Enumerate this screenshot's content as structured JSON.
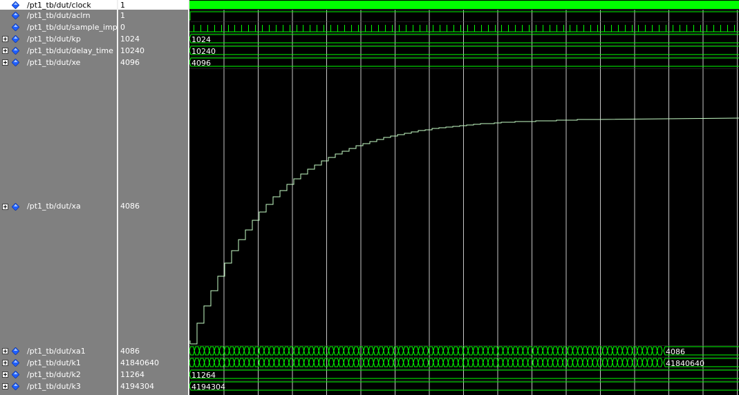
{
  "signals": [
    {
      "name": "/pt1_tb/dut/clock",
      "value": "1",
      "expandable": false,
      "selected": true,
      "kind": "clock"
    },
    {
      "name": "/pt1_tb/dut/aclrn",
      "value": "1",
      "expandable": false,
      "selected": false,
      "kind": "logic"
    },
    {
      "name": "/pt1_tb/dut/sample_imp",
      "value": "0",
      "expandable": false,
      "selected": false,
      "kind": "pulse"
    },
    {
      "name": "/pt1_tb/dut/kp",
      "value": "1024",
      "expandable": true,
      "selected": false,
      "kind": "bus",
      "bus_label": "1024"
    },
    {
      "name": "/pt1_tb/dut/delay_time",
      "value": "10240",
      "expandable": true,
      "selected": false,
      "kind": "bus",
      "bus_label": "10240"
    },
    {
      "name": "/pt1_tb/dut/xe",
      "value": "4096",
      "expandable": true,
      "selected": false,
      "kind": "bus",
      "bus_label": "4096"
    },
    {
      "name": "/pt1_tb/dut/xa",
      "value": "4086",
      "expandable": true,
      "selected": false,
      "kind": "analog"
    },
    {
      "name": "/pt1_tb/dut/xa1",
      "value": "4086",
      "expandable": true,
      "selected": false,
      "kind": "busy",
      "bus_label": "4086"
    },
    {
      "name": "/pt1_tb/dut/k1",
      "value": "41840640",
      "expandable": true,
      "selected": false,
      "kind": "busy",
      "bus_label": "41840640"
    },
    {
      "name": "/pt1_tb/dut/k2",
      "value": "11264",
      "expandable": true,
      "selected": false,
      "kind": "bus",
      "bus_label": "11264"
    },
    {
      "name": "/pt1_tb/dut/k3",
      "value": "4194304",
      "expandable": true,
      "selected": false,
      "kind": "bus",
      "bus_label": "4194304"
    }
  ],
  "colors": {
    "wave": "#00ff00",
    "grid": "#c8c8c8",
    "panel": "#808080",
    "background": "#000000",
    "analog": "#c8ffc8",
    "diamond": "#2060ff"
  },
  "icons": {
    "signal": "diamond-signal-icon",
    "expand": "plus-expand-icon"
  }
}
